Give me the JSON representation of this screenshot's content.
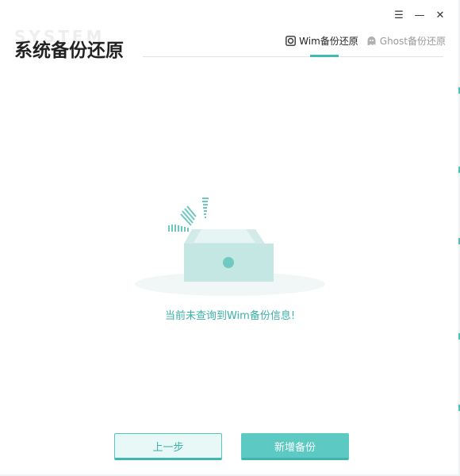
{
  "window": {
    "controls": {
      "menu": "☰",
      "minimize": "—",
      "close": "✕"
    }
  },
  "header": {
    "watermark": "SYSTEM",
    "title": "系统备份还原"
  },
  "tabs": [
    {
      "label": "Wim备份还原",
      "icon": "wim-disk-icon",
      "active": true
    },
    {
      "label": "Ghost备份还原",
      "icon": "ghost-icon",
      "active": false
    }
  ],
  "main": {
    "illustration": "empty-drawer-icon",
    "empty_message": "当前未查询到Wim备份信息!"
  },
  "footer": {
    "prev_label": "上一步",
    "new_backup_label": "新增备份"
  },
  "colors": {
    "accent": "#3dbcb4",
    "accent_text": "#3ab1a9",
    "drawer": "#cfe9e6"
  }
}
